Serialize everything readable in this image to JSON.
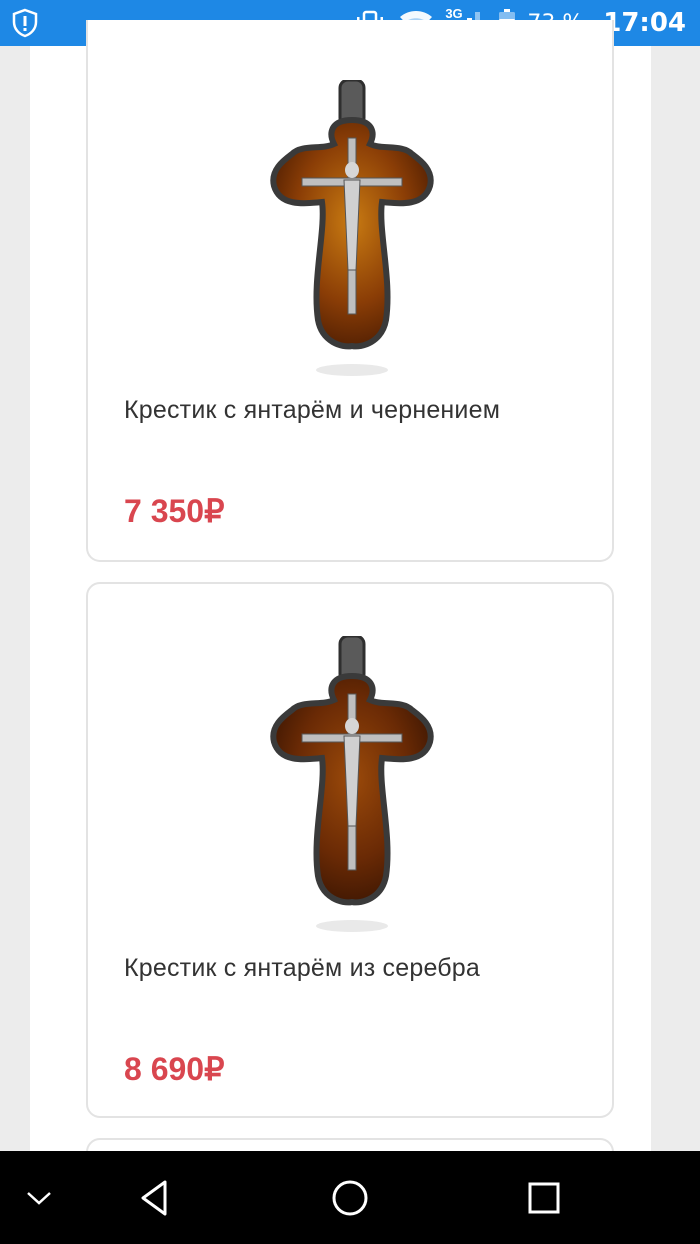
{
  "status_bar": {
    "network_type": "3G",
    "battery_percent": "73 %",
    "time": "17:04",
    "background_color": "#1e88e5",
    "icons": [
      "alert-shield-icon",
      "vibrate-icon",
      "wifi-icon",
      "cellular-signal-icon",
      "battery-icon"
    ]
  },
  "products": [
    {
      "title": "Крестик с янтарём и чернением",
      "price": "7 350₽",
      "image": "amber-cross-pendant"
    },
    {
      "title": "Крестик с янтарём из серебра",
      "price": "8 690₽",
      "image": "amber-cross-pendant"
    }
  ],
  "colors": {
    "price": "#d9464f",
    "title": "#333333",
    "card_border": "#e3e3e3",
    "nav_background": "#000000"
  },
  "nav_bar": {
    "icons": [
      "collapse-chevron-icon",
      "back-icon",
      "home-icon",
      "recents-icon"
    ]
  }
}
